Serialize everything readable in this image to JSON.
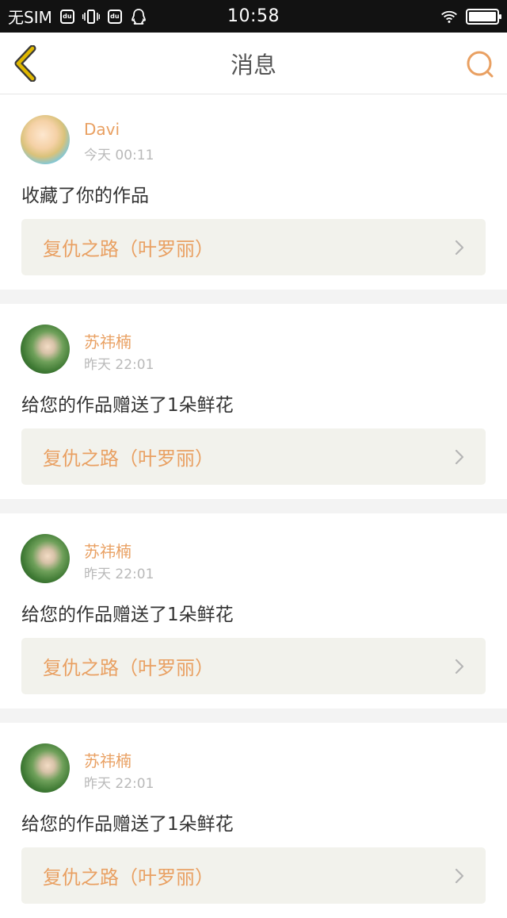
{
  "status_bar": {
    "carrier": "无SIM",
    "time": "10:58"
  },
  "nav": {
    "title": "消息",
    "back_icon": "chevron-left-icon",
    "search_icon": "search-icon",
    "accent": "#e9a062",
    "back_color": "#e0b800"
  },
  "messages": [
    {
      "name": "Davi",
      "time": "今天 00:11",
      "text": "收藏了你的作品",
      "work": "复仇之路（叶罗丽）"
    },
    {
      "name": "苏祎楠",
      "time": "昨天 22:01",
      "text": "给您的作品赠送了1朵鲜花",
      "work": "复仇之路（叶罗丽）"
    },
    {
      "name": "苏祎楠",
      "time": "昨天 22:01",
      "text": "给您的作品赠送了1朵鲜花",
      "work": "复仇之路（叶罗丽）"
    },
    {
      "name": "苏祎楠",
      "time": "昨天 22:01",
      "text": "给您的作品赠送了1朵鲜花",
      "work": "复仇之路（叶罗丽）"
    }
  ]
}
